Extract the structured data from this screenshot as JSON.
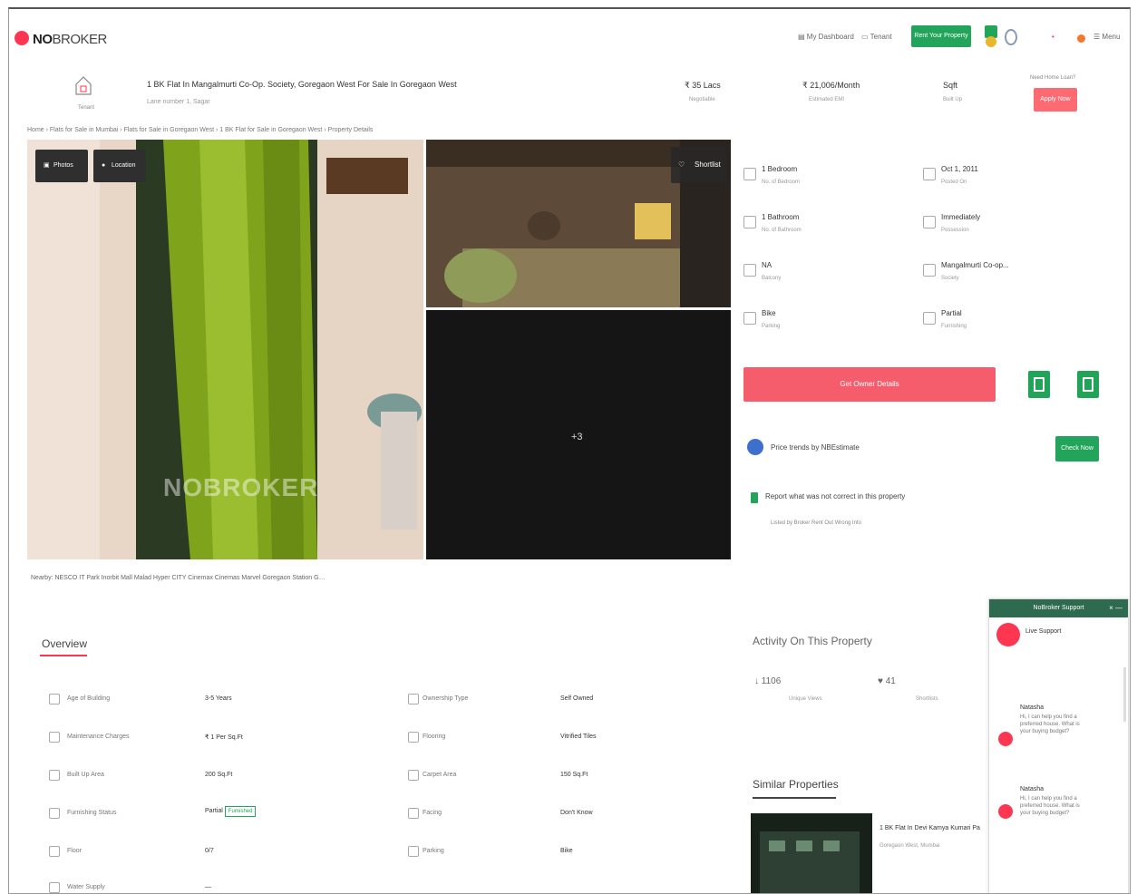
{
  "header": {
    "logo_part1": "NO",
    "logo_part2": "BROKER",
    "nav_items": [
      "My Dashboard",
      "Tenant",
      "Rent Your Property",
      "Menu"
    ]
  },
  "listing": {
    "house_label": "Tenant",
    "title": "1 BK Flat In Mangalmurti Co-Op. Society, Goregaon West For Sale In Goregaon West",
    "subtitle": "Lane number 1, Sagar",
    "price": "₹ 35 Lacs",
    "price_label": "Negotiable",
    "emi": "₹ 21,006/Month",
    "emi_label": "Estimated EMI",
    "area": "Sqft",
    "area_label": "Built Up",
    "need_loan": "Need Home Loan?",
    "apply_btn": "Apply Now"
  },
  "breadcrumb": "Home › Flats for Sale in Mumbai › Flats for Sale in Goregaon West › 1 BK Flat for Sale in Goregaon West › Property Details",
  "gallery": {
    "photos_btn": "Photos",
    "location_btn": "Location",
    "shortlist": "Shortlist",
    "more": "+3",
    "watermark": "NOBROKER"
  },
  "nearby": "Nearby:  NESCO IT Park   Inorbit Mall Malad   Hyper CITY   Cinemax Cinemas Marvel   Goregaon Station G…",
  "details": [
    {
      "icon": "bed-icon",
      "value": "1 Bedroom",
      "label": "No. of Bedroom"
    },
    {
      "icon": "calendar-icon",
      "value": "Oct 1, 2011",
      "label": "Posted On"
    },
    {
      "icon": "bath-icon",
      "value": "1 Bathroom",
      "label": "No. of Bathroom"
    },
    {
      "icon": "clock-icon",
      "value": "Immediately",
      "label": "Possession"
    },
    {
      "icon": "balcony-icon",
      "value": "NA",
      "label": "Balcony"
    },
    {
      "icon": "building-icon",
      "value": "Mangalmurti Co-op...",
      "label": "Society"
    },
    {
      "icon": "car-icon",
      "value": "Bike",
      "label": "Parking"
    },
    {
      "icon": "sofa-icon",
      "value": "Partial",
      "label": "Furnishing"
    }
  ],
  "owner_btn": "Get Owner Details",
  "price_trend": "Price trends by NBEstimate",
  "check_btn": "Check Now",
  "report": "Report what was not correct in this property",
  "report_opts": "Listed by Broker     Rent Out     Wrong Info",
  "overview": {
    "title": "Overview",
    "rows": [
      {
        "l1": "Age of Building",
        "v1": "3-5 Years",
        "l2": "Ownership Type",
        "v2": "Self Owned"
      },
      {
        "l1": "Maintenance Charges",
        "v1": "₹ 1 Per Sq.Ft",
        "l2": "Flooring",
        "v2": "Vitrified Tiles"
      },
      {
        "l1": "Built Up Area",
        "v1": "200 Sq.Ft",
        "l2": "Carpet Area",
        "v2": "150 Sq.Ft"
      },
      {
        "l1": "Furnishing Status",
        "v1": "Partial",
        "v1_tag": "Furnished",
        "l2": "Facing",
        "v2": "Don't Know"
      },
      {
        "l1": "Floor",
        "v1": "0/7",
        "l2": "Parking",
        "v2": "Bike"
      },
      {
        "l1": "Water Supply",
        "v1": "—",
        "l2": "",
        "v2": ""
      }
    ]
  },
  "activity": {
    "title": "Activity On This Property",
    "views": "1106",
    "views_label": "Unique Views",
    "shortlists": "41",
    "shortlists_label": "Shortlists"
  },
  "similar": {
    "title": "Similar Properties",
    "card_title": "1 BK Flat In Devi Kamya Kumari Pa",
    "card_sub": "Goregaon West, Mumbai"
  },
  "chat": {
    "header": "NoBroker Support",
    "close": "× —",
    "agent": "Live Support",
    "messages": [
      {
        "name": "Natasha",
        "text": "Hi, I can help you find a preferred house. What is your buying budget?"
      },
      {
        "name": "Natasha",
        "text": "Hi, I can help you find a preferred house. What is your buying budget?"
      }
    ]
  },
  "colors": {
    "brand_red": "#fd3752",
    "green": "#22a55a",
    "owner_btn": "#f65d6c"
  }
}
